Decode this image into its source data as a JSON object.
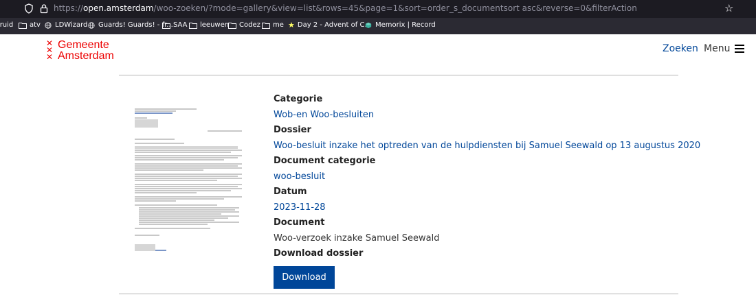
{
  "browser": {
    "url_prefix": "https://",
    "url_domain": "open.amsterdam",
    "url_path": "/woo-zoeken/?mode=gallery&view=list&rows=45&page=1&sort=order_s_documentsort asc&reverse=0&filterAction",
    "bookmarks": [
      {
        "label": "Druid",
        "icon": "folder-icon"
      },
      {
        "label": "atv",
        "icon": "folder-icon"
      },
      {
        "label": "LDWizard",
        "icon": "globe-icon"
      },
      {
        "label": "Guards! Guards! - fr...",
        "icon": "globe-icon"
      },
      {
        "label": "SAA",
        "icon": "folder-icon"
      },
      {
        "label": "leeuwen",
        "icon": "folder-icon"
      },
      {
        "label": "Codez",
        "icon": "folder-icon"
      },
      {
        "label": "me",
        "icon": "folder-icon"
      },
      {
        "label": "Day 2 - Advent of C...",
        "icon": "star-icon"
      },
      {
        "label": "Memorix | Record",
        "icon": "memorix-icon"
      }
    ]
  },
  "header": {
    "logo_line1": "Gemeente",
    "logo_line2": "Amsterdam",
    "search_label": "Zoeken",
    "menu_label": "Menu"
  },
  "document": {
    "fields": [
      {
        "label": "Categorie",
        "value": "Wob-en Woo-besluiten",
        "link": true
      },
      {
        "label": "Dossier",
        "value": "Woo-besluit inzake het optreden van de hulpdiensten bij Samuel Seewald op 13 augustus 2020",
        "link": true
      },
      {
        "label": "Document categorie",
        "value": "woo-besluit",
        "link": true
      },
      {
        "label": "Datum",
        "value": "2023-11-28",
        "link": true
      },
      {
        "label": "Document",
        "value": "Woo-verzoek inzake Samuel Seewald",
        "link": false
      }
    ],
    "download_label": "Download dossier",
    "download_button": "Download"
  },
  "colors": {
    "brand_red": "#ec0000",
    "link_blue": "#004699",
    "button_blue": "#004699"
  }
}
